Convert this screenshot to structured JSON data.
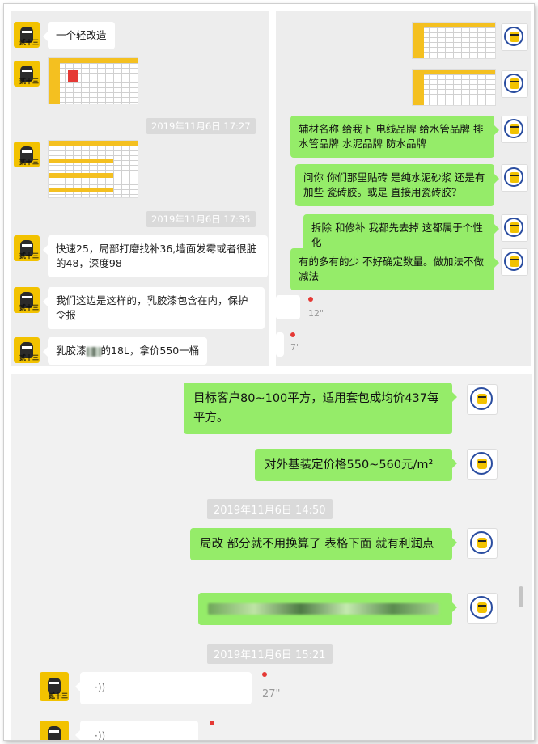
{
  "left_panel": {
    "messages": [
      {
        "type": "text",
        "text": "一个轻改造"
      },
      {
        "type": "image",
        "alt": "spreadsheet-1"
      },
      {
        "type": "timestamp",
        "text": "2019年11月6日 17:27"
      },
      {
        "type": "image",
        "alt": "spreadsheet-2"
      },
      {
        "type": "timestamp",
        "text": "2019年11月6日 17:35"
      },
      {
        "type": "text",
        "text": "快速25，局部打磨找补36,墙面发霉或者很脏的48，深度98"
      },
      {
        "type": "text",
        "text": "我们这边是这样的，乳胶漆包含在内，保护令报"
      },
      {
        "type": "text",
        "prefix": "乳胶漆",
        "suffix": "的18L，拿价550一桶"
      }
    ],
    "avatar_label": "贰十三"
  },
  "right_panel": {
    "messages": [
      {
        "type": "image",
        "alt": "spreadsheet-3"
      },
      {
        "type": "image",
        "alt": "spreadsheet-4"
      },
      {
        "type": "text",
        "text": "辅材名称 给我下  电线品牌  给水管品牌   排水管品牌  水泥品牌   防水品牌"
      },
      {
        "type": "text",
        "text": "问你 你们那里贴砖 是纯水泥砂浆 还是有加些 瓷砖胶。或是 直接用瓷砖胶？"
      },
      {
        "type": "text",
        "text": "拆除 和修补 我都先去掉 这都属于个性化"
      },
      {
        "type": "text",
        "text": "有的多有的少 不好确定数量。做加法不做减法"
      },
      {
        "type": "voice",
        "duration": "12\""
      },
      {
        "type": "voice",
        "duration": "7\""
      }
    ]
  },
  "bottom_panel": {
    "messages": [
      {
        "type": "text",
        "text": "目标客户80~100平方，适用套包成均价437每平方。"
      },
      {
        "type": "text",
        "text": "对外基装定价格550~560元/m²"
      },
      {
        "type": "timestamp",
        "text": "2019年11月6日  14:50"
      },
      {
        "type": "text",
        "text": "局改 部分就不用换算了 表格下面 就有利润点"
      },
      {
        "type": "blurred"
      },
      {
        "type": "timestamp",
        "text": "2019年11月6日  15:21"
      },
      {
        "type": "voice",
        "duration": "27\""
      },
      {
        "type": "voice",
        "duration": ""
      }
    ],
    "avatar_label": "贰十三"
  },
  "colors": {
    "green_bubble": "#95ec69",
    "white_bubble": "#ffffff",
    "panel_bg": "#ededed",
    "unread_dot": "#e53935"
  }
}
